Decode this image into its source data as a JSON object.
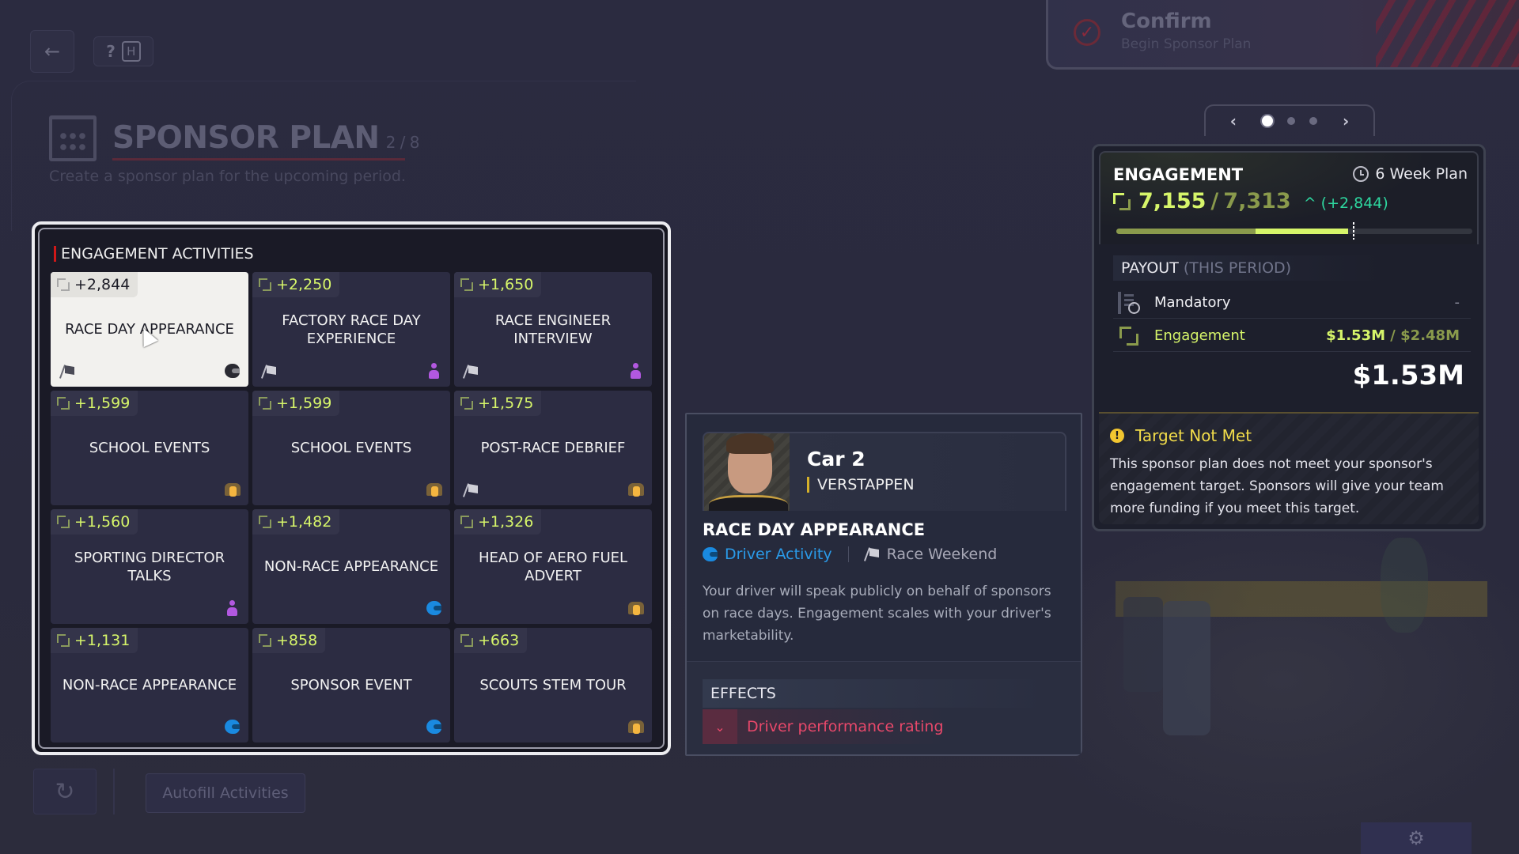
{
  "header": {
    "back_icon": "arrow-left-icon",
    "help_label": "?",
    "help_key": "H",
    "title": "SPONSOR PLAN",
    "step": "2 / 8",
    "subtitle": "Create a sponsor plan for the upcoming period."
  },
  "confirm": {
    "title": "Confirm",
    "subtitle": "Begin Sponsor Plan",
    "icon": "check-circle-icon"
  },
  "pager": {
    "prev": "‹",
    "next": "›",
    "pages": 3,
    "active_page": 1
  },
  "activities": {
    "title": "ENGAGEMENT ACTIVITIES",
    "items": [
      {
        "value": "+2,844",
        "name": "RACE DAY APPEARANCE",
        "left_icon": "race-weekend-flag-icon",
        "right_icon": "helmet-icon",
        "selected": true
      },
      {
        "value": "+2,250",
        "name": "FACTORY RACE DAY EXPERIENCE",
        "left_icon": "race-weekend-flag-icon",
        "right_icon": "person-icon",
        "selected": false
      },
      {
        "value": "+1,650",
        "name": "RACE ENGINEER INTERVIEW",
        "left_icon": "race-weekend-flag-icon",
        "right_icon": "person-icon",
        "selected": false
      },
      {
        "value": "+1,599",
        "name": "SCHOOL EVENTS",
        "left_icon": "",
        "right_icon": "group-icon",
        "selected": false
      },
      {
        "value": "+1,599",
        "name": "SCHOOL EVENTS",
        "left_icon": "",
        "right_icon": "group-icon",
        "selected": false
      },
      {
        "value": "+1,575",
        "name": "POST-RACE DEBRIEF",
        "left_icon": "race-weekend-flag-icon",
        "right_icon": "group-icon",
        "selected": false
      },
      {
        "value": "+1,560",
        "name": "SPORTING DIRECTOR TALKS",
        "left_icon": "",
        "right_icon": "person-icon",
        "selected": false
      },
      {
        "value": "+1,482",
        "name": "NON-RACE APPEARANCE",
        "left_icon": "",
        "right_icon": "helmet-icon",
        "selected": false
      },
      {
        "value": "+1,326",
        "name": "HEAD OF AERO FUEL ADVERT",
        "left_icon": "",
        "right_icon": "group-icon",
        "selected": false
      },
      {
        "value": "+1,131",
        "name": "NON-RACE APPEARANCE",
        "left_icon": "",
        "right_icon": "helmet-icon",
        "selected": false
      },
      {
        "value": "+858",
        "name": "SPONSOR EVENT",
        "left_icon": "",
        "right_icon": "helmet-icon",
        "selected": false
      },
      {
        "value": "+663",
        "name": "SCOUTS STEM TOUR",
        "left_icon": "",
        "right_icon": "group-icon",
        "selected": false
      }
    ]
  },
  "footer": {
    "reset_icon": "refresh-icon",
    "autofill_label": "Autofill Activities",
    "settings_icon": "gear-icon"
  },
  "detail": {
    "car": "Car 2",
    "driver": "VERSTAPPEN",
    "activity": "RACE DAY APPEARANCE",
    "type_tag": "Driver Activity",
    "timing_tag": "Race Weekend",
    "description": "Your driver will speak publicly on behalf of sponsors on race days. Engagement scales with your driver's marketability.",
    "effects_title": "EFFECTS",
    "effects": [
      {
        "label": "Driver performance rating",
        "direction": "down"
      }
    ],
    "colors": {
      "driver_activity": "#2a9ae8",
      "negative_effect": "#e8486a"
    }
  },
  "engagement": {
    "title": "ENGAGEMENT",
    "plan_length": "6 Week Plan",
    "current": "7,155",
    "target": "7,313",
    "delta": "(+2,844)",
    "current_value": 7155,
    "target_value": 7313,
    "delta_value": 2844,
    "bar_max_value": 11000,
    "payout_title": "PAYOUT",
    "payout_qualifier": "(THIS PERIOD)",
    "rows": [
      {
        "label": "Mandatory",
        "value": "-"
      },
      {
        "label": "Engagement",
        "value_current": "$1.53M",
        "value_max": "$2.48M"
      }
    ],
    "total": "$1.53M",
    "colors": {
      "accent": "#d6f56a",
      "muted_accent": "#8a9a4c",
      "delta": "#2ed8a0"
    }
  },
  "warning": {
    "title": "Target Not Met",
    "text": "This sponsor plan does not meet your sponsor's engagement target. Sponsors will give your team more funding if you meet this target.",
    "color": "#f2dc4a"
  }
}
